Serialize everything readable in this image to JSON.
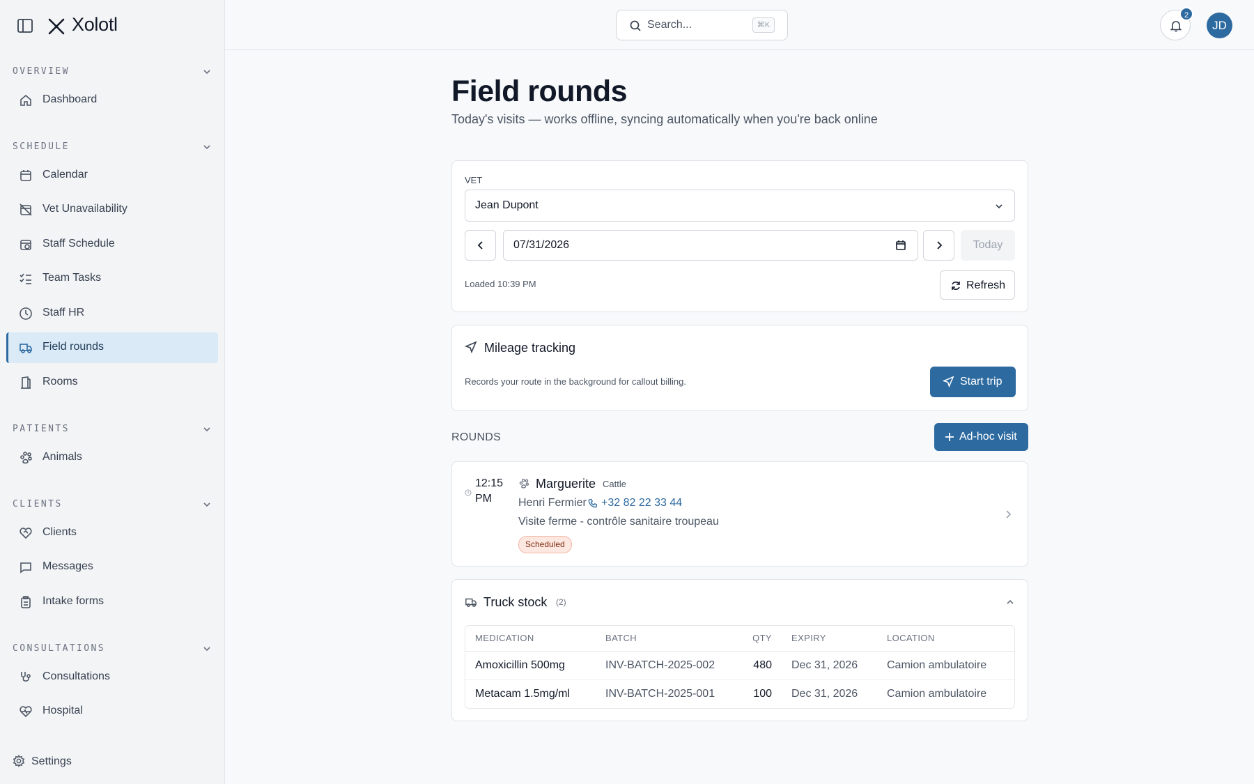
{
  "app": {
    "name": "Xolotl"
  },
  "search": {
    "placeholder": "Search...",
    "shortcut": "⌘K"
  },
  "notifications": {
    "count": "2"
  },
  "user": {
    "initials": "JD"
  },
  "sidebar": {
    "sections": [
      {
        "label": "OVERVIEW",
        "items": [
          {
            "label": "Dashboard",
            "icon": "home-icon"
          }
        ]
      },
      {
        "label": "SCHEDULE",
        "items": [
          {
            "label": "Calendar",
            "icon": "calendar-icon"
          },
          {
            "label": "Vet Unavailability",
            "icon": "calendar-off-icon"
          },
          {
            "label": "Staff Schedule",
            "icon": "calendar-clock-icon"
          },
          {
            "label": "Team Tasks",
            "icon": "list-checks-icon"
          },
          {
            "label": "Staff HR",
            "icon": "clock-icon"
          },
          {
            "label": "Field rounds",
            "icon": "truck-icon",
            "active": true
          },
          {
            "label": "Rooms",
            "icon": "door-icon"
          }
        ]
      },
      {
        "label": "PATIENTS",
        "items": [
          {
            "label": "Animals",
            "icon": "paw-icon"
          }
        ]
      },
      {
        "label": "CLIENTS",
        "items": [
          {
            "label": "Clients",
            "icon": "heart-handshake-icon"
          },
          {
            "label": "Messages",
            "icon": "message-square-icon"
          },
          {
            "label": "Intake forms",
            "icon": "clipboard-icon"
          }
        ]
      },
      {
        "label": "CONSULTATIONS",
        "items": [
          {
            "label": "Consultations",
            "icon": "stethoscope-icon"
          },
          {
            "label": "Hospital",
            "icon": "heart-pulse-icon"
          }
        ]
      }
    ],
    "settings_label": "Settings"
  },
  "page": {
    "title": "Field rounds",
    "subtitle": "Today's visits — works offline, syncing automatically when you're back online"
  },
  "filters": {
    "vet_label": "VET",
    "vet_value": "Jean Dupont",
    "date_value": "07/31/2026",
    "today_label": "Today",
    "loaded_text": "Loaded 10:39 PM",
    "refresh_label": "Refresh"
  },
  "mileage": {
    "title": "Mileage tracking",
    "description": "Records your route in the background for callout billing.",
    "start_label": "Start trip"
  },
  "rounds": {
    "label": "ROUNDS",
    "adhoc_label": "Ad-hoc visit",
    "visits": [
      {
        "time": "12:15 PM",
        "animal": "Marguerite",
        "species": "Cattle",
        "owner": "Henri Fermier",
        "phone": "+32 82 22 33 44",
        "reason": "Visite ferme - contrôle sanitaire troupeau",
        "status": "Scheduled"
      }
    ]
  },
  "truck_stock": {
    "title": "Truck stock",
    "count": "(2)",
    "columns": [
      "MEDICATION",
      "BATCH",
      "QTY",
      "EXPIRY",
      "LOCATION"
    ],
    "rows": [
      {
        "medication": "Amoxicillin 500mg",
        "batch": "INV-BATCH-2025-002",
        "qty": "480",
        "expiry": "Dec 31, 2026",
        "location": "Camion ambulatoire"
      },
      {
        "medication": "Metacam 1.5mg/ml",
        "batch": "INV-BATCH-2025-001",
        "qty": "100",
        "expiry": "Dec 31, 2026",
        "location": "Camion ambulatoire"
      }
    ]
  },
  "colors": {
    "accent": "#2d6aa0",
    "active_bg": "#dbeaf7",
    "badge_bg": "#fde8e1"
  }
}
